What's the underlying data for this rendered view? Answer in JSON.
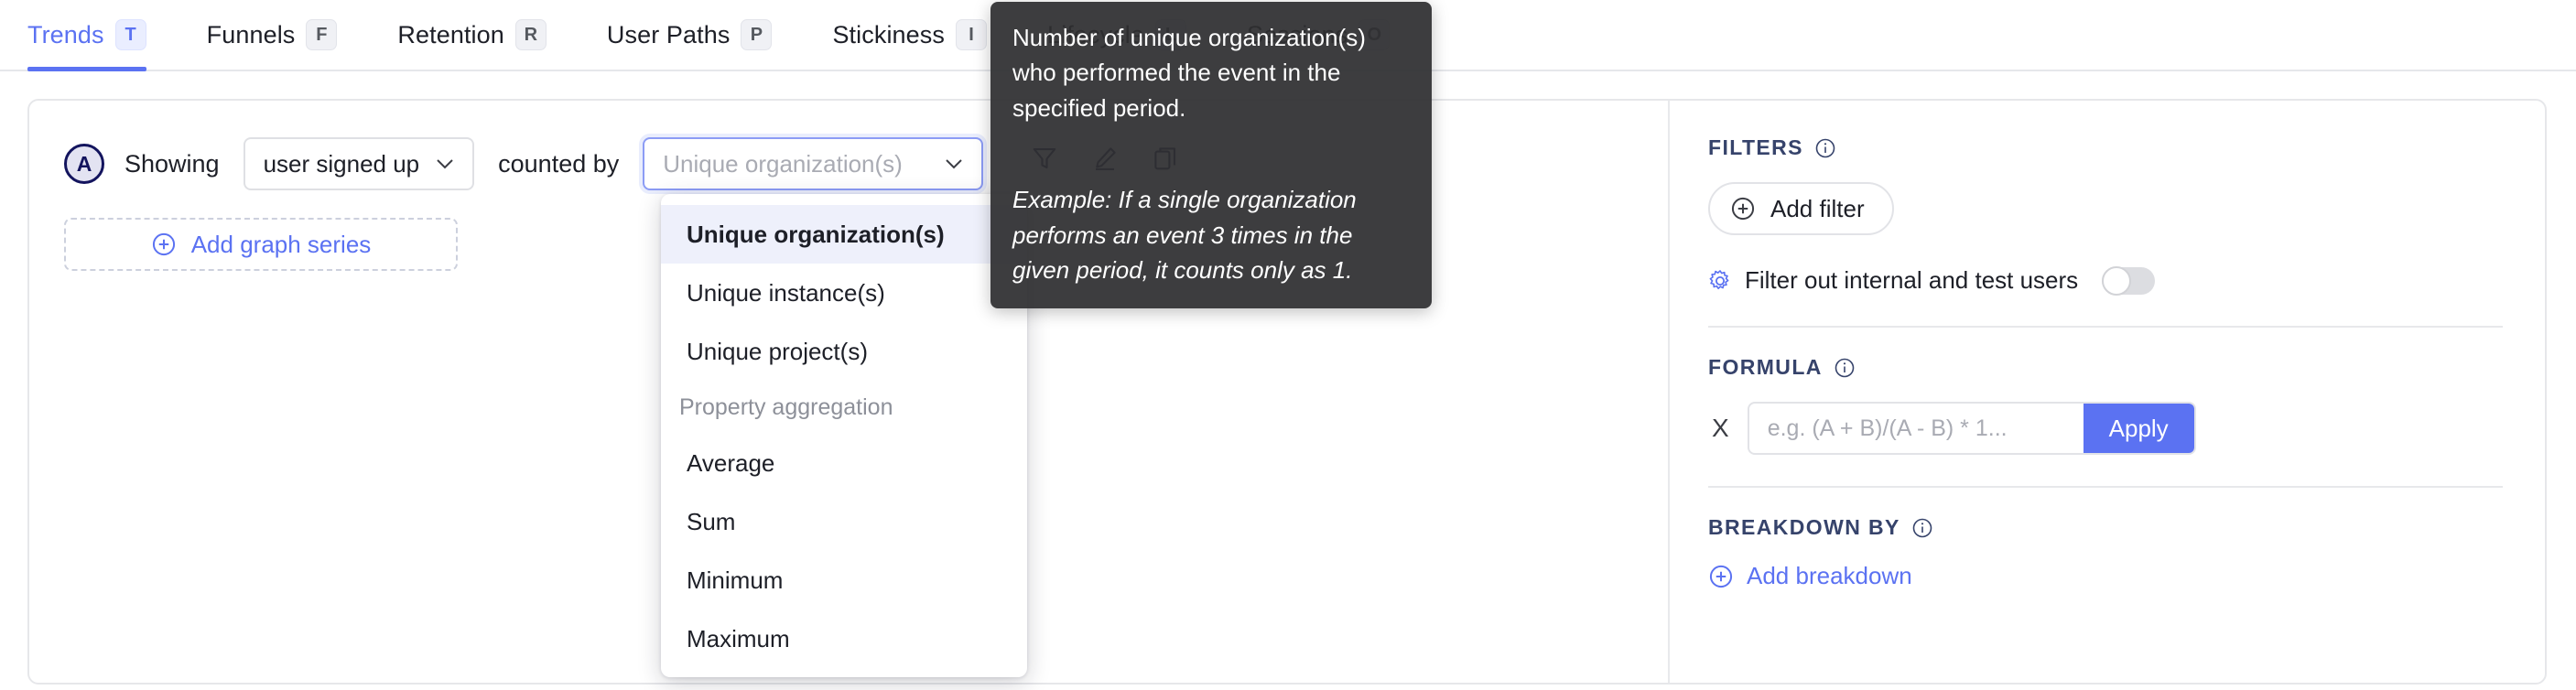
{
  "tabs": [
    {
      "label": "Trends",
      "key": "T",
      "active": true
    },
    {
      "label": "Funnels",
      "key": "F",
      "active": false
    },
    {
      "label": "Retention",
      "key": "R",
      "active": false
    },
    {
      "label": "User Paths",
      "key": "P",
      "active": false
    },
    {
      "label": "Stickiness",
      "key": "I",
      "active": false
    },
    {
      "label": "Lifecycle",
      "key": "L",
      "active": false
    },
    {
      "label": "Sessions",
      "key": "O",
      "active": false
    }
  ],
  "series": {
    "badge": "A",
    "showing_label": "Showing",
    "event_value": "user signed up",
    "counted_by_label": "counted by",
    "aggregation_placeholder": "Unique organization(s)",
    "add_series_label": "Add graph series"
  },
  "dropdown": {
    "items": [
      {
        "label": "Unique organization(s)",
        "selected": true
      },
      {
        "label": "Unique instance(s)",
        "selected": false
      },
      {
        "label": "Unique project(s)",
        "selected": false
      }
    ],
    "group_label": "Property aggregation",
    "aggregations": [
      {
        "label": "Average"
      },
      {
        "label": "Sum"
      },
      {
        "label": "Minimum"
      },
      {
        "label": "Maximum"
      }
    ]
  },
  "tooltip": {
    "body": "Number of unique organization(s) who performed the event in the specified period.",
    "example": "Example: If a single organization performs an event 3 times in the given period, it counts only as 1."
  },
  "row_actions": [
    {
      "name": "filter-icon"
    },
    {
      "name": "edit-icon"
    },
    {
      "name": "duplicate-icon"
    }
  ],
  "filters": {
    "title": "FILTERS",
    "add_filter_label": "Add filter",
    "internal_users_label": "Filter out internal and test users",
    "internal_users_enabled": false
  },
  "formula": {
    "title": "FORMULA",
    "placeholder": "e.g. (A + B)/(A - B) * 1...",
    "value": "",
    "apply_label": "Apply",
    "clear_label": "X"
  },
  "breakdown": {
    "title": "BREAKDOWN BY",
    "add_breakdown_label": "Add breakdown"
  },
  "colors": {
    "accent": "#5b72f2",
    "heading": "#36436b",
    "badge_border": "#13145e",
    "tooltip_bg": "#2e2e30"
  }
}
